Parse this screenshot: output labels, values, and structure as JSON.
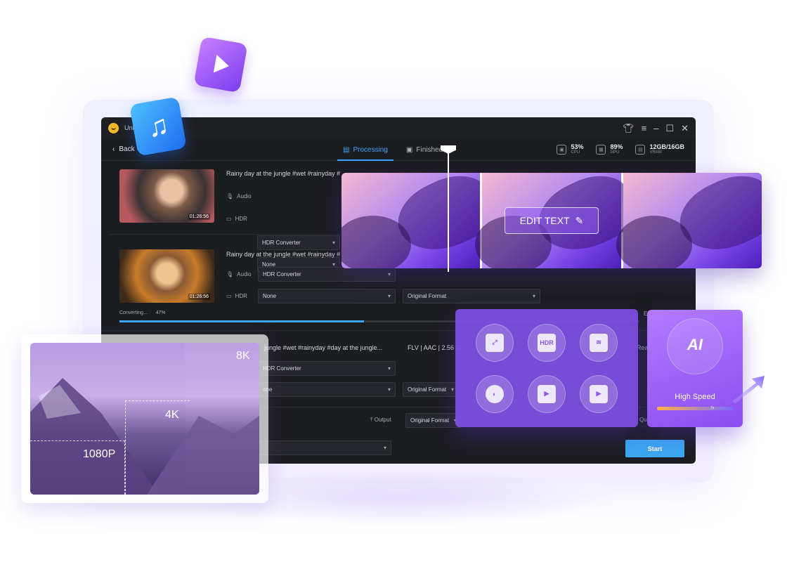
{
  "app": {
    "title": "Uni",
    "back_label": "Back",
    "tabs": [
      {
        "label": "Processing",
        "active": true
      },
      {
        "label": "Finished",
        "active": false
      }
    ],
    "stats": [
      {
        "value": "53%",
        "label": "CPU"
      },
      {
        "value": "89%",
        "label": "GPU"
      },
      {
        "value": "12GB/16GB",
        "label": "VRAM"
      }
    ]
  },
  "rows": [
    {
      "title": "Rainy day at the jungle #wet #rainyday #",
      "duration": "01:26:56",
      "audio_label": "Audio",
      "audio_value": "HDR Converter",
      "hdr_label": "HDR",
      "hdr_value": "None"
    },
    {
      "title": "Rainy day at the jungle #wet #rainyday #",
      "duration": "01:26:56",
      "audio_label": "Audio",
      "audio_value": "HDR Converter",
      "hdr_label": "HDR",
      "hdr_value": "None",
      "format_value": "Original Format",
      "progress_label": "Converting...",
      "progress_percent": "47%",
      "progress_fraction": 0.47,
      "side_text": "E"
    },
    {
      "title": "jungle #wet #rainyday #day at the jungle...",
      "meta": "FLV | AAC | 2.56 G",
      "audio_value": "HDR Converter",
      "hdr_value": "one",
      "format_value": "Original Format",
      "side_text": "Rea"
    }
  ],
  "bottom": {
    "output_label": "Output",
    "output_value": "Original Format",
    "quality_fragment": "Qu",
    "start_label": "Start"
  },
  "overlays": {
    "edit_text_label": "EDIT TEXT",
    "tools": [
      "expand",
      "HDR",
      "noise",
      "color",
      "frames",
      "stabilize"
    ],
    "ai_label": "AI",
    "speed_label": "High Speed",
    "speed_badge": "7x",
    "res_labels": [
      "8K",
      "4K",
      "1080P"
    ]
  }
}
